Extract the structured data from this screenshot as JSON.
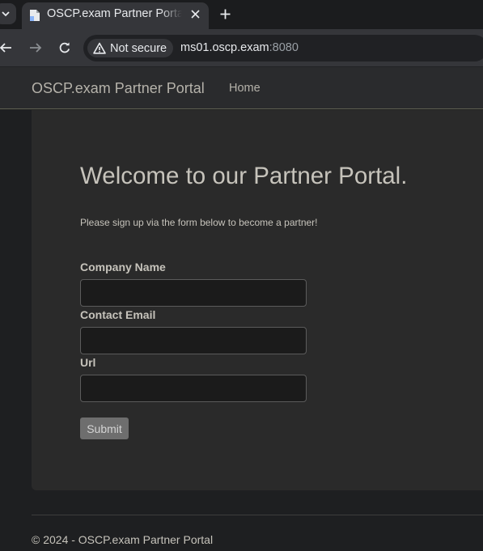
{
  "browser": {
    "tab": {
      "title": "OSCP.exam Partner Portal",
      "favicon": "document-icon",
      "close_icon": "close-icon"
    },
    "tab_dropdown_icon": "chevron-down-icon",
    "new_tab_icon": "plus-icon",
    "toolbar": {
      "back_icon": "arrow-left-icon",
      "forward_icon": "arrow-right-icon",
      "reload_icon": "reload-icon"
    },
    "omnibox": {
      "security_icon": "warning-triangle-icon",
      "security_label": "Not secure",
      "url_host": "ms01.oscp.exam",
      "url_port": ":8080"
    }
  },
  "site": {
    "brand": "OSCP.exam Partner Portal",
    "nav": [
      {
        "label": "Home"
      }
    ]
  },
  "main": {
    "heading": "Welcome to our Partner Portal.",
    "subheading": "Please sign up via the form below to become a partner!",
    "form": {
      "fields": [
        {
          "label": "Company Name",
          "value": ""
        },
        {
          "label": "Contact Email",
          "value": ""
        },
        {
          "label": "Url",
          "value": ""
        }
      ],
      "submit_label": "Submit"
    }
  },
  "footer": {
    "text": "© 2024 - OSCP.exam Partner Portal"
  },
  "colors": {
    "page_background": "#212121",
    "panel_background": "#2a2a2a",
    "text": "#c6c3bb",
    "button": "#6e6e6e"
  }
}
